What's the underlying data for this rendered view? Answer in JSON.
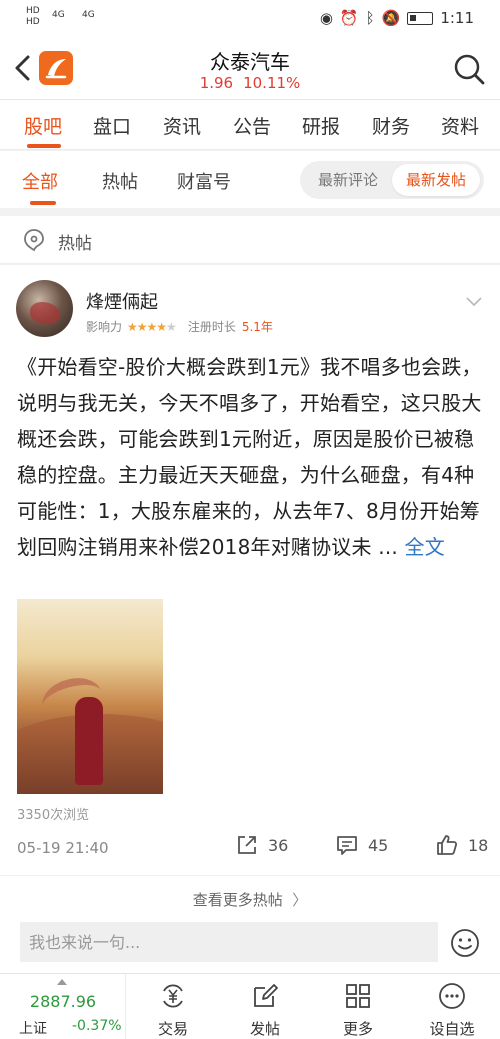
{
  "status_bar": {
    "hd1": "HD",
    "hd2": "HD",
    "signal1": "4G",
    "signal2": "4G",
    "time": "1:11"
  },
  "header": {
    "stock_name": "众泰汽车",
    "price": "1.96",
    "change_pct": "10.11%",
    "price_color": "#e23b30",
    "back_icon": "chevron-left-icon",
    "search_icon": "search-icon"
  },
  "tabs": [
    "股吧",
    "盘口",
    "资讯",
    "公告",
    "研报",
    "财务",
    "资料"
  ],
  "subtabs": [
    "全部",
    "热帖",
    "财富号"
  ],
  "sort_options": [
    "最新评论",
    "最新发帖"
  ],
  "accent_color": "#e9541c",
  "section": {
    "label": "热帖"
  },
  "post": {
    "username": "烽煙倆起",
    "influence_label": "影响力",
    "influence_stars": 4.5,
    "reg_label": "注册时长",
    "reg_value": "5.1年",
    "body_text": "《开始看空-股价大概会跌到1元》我不唱多也会跌，说明与我无关，今天不唱多了，开始看空，这只股大概还会跌，可能会跌到1元附近，原因是股价已被稳稳的控盘。主力最近天天砸盘，为什么砸盘，有4种可能性：1，大股东雇来的，从去年7、8月份开始筹划回购注销用来补偿2018年对赌协议未 ...",
    "more_link": "全文",
    "views": "3350次浏览",
    "time": "05-19 21:40",
    "shares": "36",
    "comments": "45",
    "likes": "18"
  },
  "more_hot": "查看更多热帖",
  "comment_placeholder": "我也来说一句...",
  "bottom_nav": {
    "index_value": "2887.96",
    "index_name": "上证",
    "index_change": "-0.37%",
    "index_color": "#2d9a3e",
    "items": [
      "交易",
      "发帖",
      "更多",
      "设自选"
    ]
  }
}
